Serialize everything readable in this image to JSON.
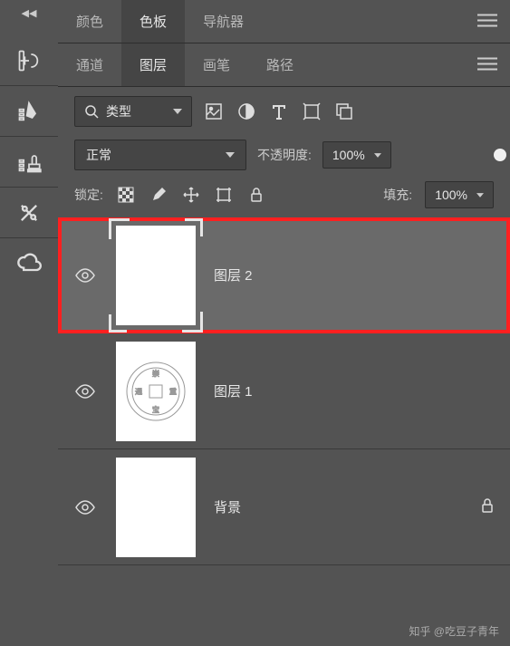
{
  "top_tabs": {
    "items": [
      "颜色",
      "色板",
      "导航器"
    ],
    "active": 1
  },
  "panel_tabs": {
    "items": [
      "通道",
      "图层",
      "画笔",
      "路径"
    ],
    "active": 1
  },
  "filter": {
    "type_label": "类型"
  },
  "blend": {
    "mode": "正常",
    "opacity_label": "不透明度:",
    "opacity_value": "100%"
  },
  "lock": {
    "label": "锁定:",
    "fill_label": "填充:",
    "fill_value": "100%"
  },
  "layers": [
    {
      "name": "图层 2",
      "visible": true,
      "selected": true,
      "highlighted": true,
      "locked": false,
      "thumb": "blank_brackets"
    },
    {
      "name": "图层 1",
      "visible": true,
      "selected": false,
      "highlighted": false,
      "locked": false,
      "thumb": "coin"
    },
    {
      "name": "背景",
      "visible": true,
      "selected": false,
      "highlighted": false,
      "locked": true,
      "thumb": "blank"
    }
  ],
  "watermark": "知乎 @吃豆子青年",
  "tool_icons": [
    "history-brush",
    "brush",
    "stamp",
    "tools-cross",
    "creative-cloud"
  ],
  "filter_icons": [
    "image-icon",
    "adjustment-icon",
    "text-icon",
    "crop-icon",
    "artboard-icon"
  ],
  "lock_icons": [
    "transparency-lock",
    "brush-lock",
    "move-lock",
    "crop-lock",
    "lock-all"
  ]
}
